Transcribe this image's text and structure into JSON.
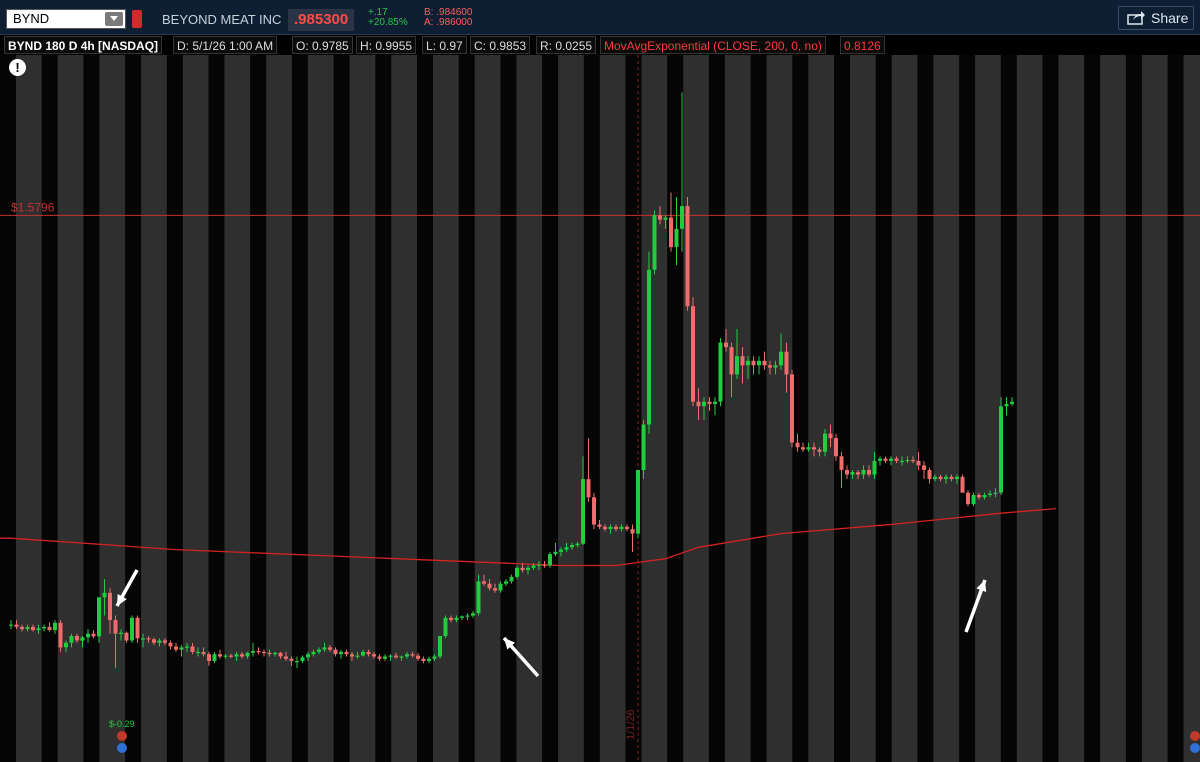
{
  "header": {
    "symbol": "BYND",
    "company": "BEYOND MEAT INC",
    "last": ".985300",
    "change": "+.17",
    "change_pct": "+20.85%",
    "bid": "B: .984600",
    "ask": "A: .986000",
    "share_label": "Share"
  },
  "infobar": {
    "study": "BYND 180 D 4h [NASDAQ]",
    "date": "D: 5/1/26 1:00 AM",
    "open": "O: 0.9785",
    "high": "H: 0.9955",
    "low": "L: 0.97",
    "close": "C: 0.9853",
    "range": "R: 0.0255",
    "ma_label": "MovAvgExponential (CLOSE, 200, 0, no)",
    "ma_value": "0.8126"
  },
  "alert_icon": "exclamation-icon",
  "colors": {
    "up": "#22cc3f",
    "down": "#f06b6b",
    "ma": "#d42222",
    "level": "#c43232",
    "info_white": "#ffffff",
    "info_red": "#ff3b3b"
  },
  "chart_data": {
    "type": "candlestick",
    "price_line": {
      "label": "$1.5796",
      "value": 1.5796
    },
    "earnings_label": "$-0.29",
    "date_marker": "1/1/26",
    "ylim": [
      0.4,
      1.93
    ],
    "candles": [
      [
        0.68,
        0.69,
        0.67,
        0.68
      ],
      [
        0.68,
        0.69,
        0.67,
        0.675
      ],
      [
        0.675,
        0.68,
        0.665,
        0.67
      ],
      [
        0.67,
        0.68,
        0.665,
        0.675
      ],
      [
        0.675,
        0.68,
        0.665,
        0.668
      ],
      [
        0.668,
        0.68,
        0.66,
        0.672
      ],
      [
        0.672,
        0.68,
        0.665,
        0.675
      ],
      [
        0.675,
        0.685,
        0.665,
        0.668
      ],
      [
        0.668,
        0.69,
        0.66,
        0.684
      ],
      [
        0.684,
        0.69,
        0.62,
        0.63
      ],
      [
        0.63,
        0.645,
        0.62,
        0.64
      ],
      [
        0.64,
        0.66,
        0.63,
        0.655
      ],
      [
        0.655,
        0.66,
        0.64,
        0.645
      ],
      [
        0.645,
        0.655,
        0.63,
        0.652
      ],
      [
        0.652,
        0.67,
        0.64,
        0.66
      ],
      [
        0.66,
        0.668,
        0.65,
        0.654
      ],
      [
        0.654,
        0.7,
        0.64,
        0.74
      ],
      [
        0.74,
        0.78,
        0.7,
        0.75
      ],
      [
        0.75,
        0.76,
        0.66,
        0.69
      ],
      [
        0.69,
        0.7,
        0.585,
        0.66
      ],
      [
        0.66,
        0.67,
        0.645,
        0.662
      ],
      [
        0.662,
        0.665,
        0.64,
        0.645
      ],
      [
        0.645,
        0.7,
        0.64,
        0.695
      ],
      [
        0.695,
        0.7,
        0.64,
        0.65
      ],
      [
        0.65,
        0.66,
        0.63,
        0.65
      ],
      [
        0.65,
        0.655,
        0.64,
        0.648
      ],
      [
        0.648,
        0.652,
        0.635,
        0.64
      ],
      [
        0.64,
        0.65,
        0.632,
        0.645
      ],
      [
        0.645,
        0.65,
        0.635,
        0.64
      ],
      [
        0.64,
        0.645,
        0.625,
        0.632
      ],
      [
        0.632,
        0.64,
        0.62,
        0.625
      ],
      [
        0.625,
        0.635,
        0.61,
        0.63
      ],
      [
        0.63,
        0.64,
        0.62,
        0.632
      ],
      [
        0.632,
        0.64,
        0.615,
        0.62
      ],
      [
        0.62,
        0.63,
        0.61,
        0.62
      ],
      [
        0.62,
        0.63,
        0.61,
        0.615
      ],
      [
        0.615,
        0.62,
        0.59,
        0.6
      ],
      [
        0.6,
        0.62,
        0.595,
        0.615
      ],
      [
        0.615,
        0.625,
        0.605,
        0.61
      ],
      [
        0.61,
        0.615,
        0.605,
        0.612
      ],
      [
        0.612,
        0.616,
        0.606,
        0.61
      ],
      [
        0.61,
        0.62,
        0.6,
        0.615
      ],
      [
        0.615,
        0.62,
        0.605,
        0.61
      ],
      [
        0.61,
        0.62,
        0.605,
        0.618
      ],
      [
        0.618,
        0.64,
        0.61,
        0.622
      ],
      [
        0.622,
        0.63,
        0.615,
        0.62
      ],
      [
        0.62,
        0.625,
        0.61,
        0.618
      ],
      [
        0.618,
        0.625,
        0.61,
        0.615
      ],
      [
        0.615,
        0.62,
        0.61,
        0.618
      ],
      [
        0.618,
        0.62,
        0.605,
        0.61
      ],
      [
        0.61,
        0.62,
        0.6,
        0.605
      ],
      [
        0.605,
        0.61,
        0.59,
        0.6
      ],
      [
        0.6,
        0.61,
        0.585,
        0.6
      ],
      [
        0.6,
        0.612,
        0.595,
        0.608
      ],
      [
        0.608,
        0.62,
        0.6,
        0.615
      ],
      [
        0.615,
        0.625,
        0.61,
        0.62
      ],
      [
        0.62,
        0.63,
        0.615,
        0.625
      ],
      [
        0.625,
        0.64,
        0.62,
        0.63
      ],
      [
        0.63,
        0.635,
        0.62,
        0.625
      ],
      [
        0.625,
        0.63,
        0.61,
        0.615
      ],
      [
        0.615,
        0.625,
        0.605,
        0.62
      ],
      [
        0.62,
        0.625,
        0.61,
        0.615
      ],
      [
        0.615,
        0.62,
        0.6,
        0.61
      ],
      [
        0.61,
        0.62,
        0.605,
        0.612
      ],
      [
        0.612,
        0.625,
        0.61,
        0.62
      ],
      [
        0.62,
        0.625,
        0.61,
        0.615
      ],
      [
        0.615,
        0.62,
        0.605,
        0.61
      ],
      [
        0.61,
        0.615,
        0.6,
        0.605
      ],
      [
        0.605,
        0.615,
        0.6,
        0.61
      ],
      [
        0.61,
        0.615,
        0.6,
        0.612
      ],
      [
        0.612,
        0.618,
        0.605,
        0.608
      ],
      [
        0.608,
        0.612,
        0.6,
        0.61
      ],
      [
        0.61,
        0.62,
        0.605,
        0.615
      ],
      [
        0.615,
        0.62,
        0.608,
        0.612
      ],
      [
        0.612,
        0.618,
        0.6,
        0.605
      ],
      [
        0.605,
        0.61,
        0.595,
        0.6
      ],
      [
        0.6,
        0.61,
        0.595,
        0.605
      ],
      [
        0.605,
        0.615,
        0.6,
        0.61
      ],
      [
        0.61,
        0.65,
        0.605,
        0.655
      ],
      [
        0.655,
        0.7,
        0.65,
        0.695
      ],
      [
        0.695,
        0.7,
        0.685,
        0.69
      ],
      [
        0.69,
        0.7,
        0.685,
        0.695
      ],
      [
        0.695,
        0.7,
        0.69,
        0.698
      ],
      [
        0.698,
        0.705,
        0.69,
        0.7
      ],
      [
        0.7,
        0.71,
        0.695,
        0.705
      ],
      [
        0.705,
        0.79,
        0.7,
        0.775
      ],
      [
        0.775,
        0.79,
        0.765,
        0.77
      ],
      [
        0.77,
        0.78,
        0.755,
        0.76
      ],
      [
        0.76,
        0.77,
        0.75,
        0.755
      ],
      [
        0.755,
        0.775,
        0.75,
        0.77
      ],
      [
        0.77,
        0.78,
        0.765,
        0.775
      ],
      [
        0.775,
        0.79,
        0.77,
        0.785
      ],
      [
        0.785,
        0.81,
        0.78,
        0.805
      ],
      [
        0.805,
        0.815,
        0.795,
        0.8
      ],
      [
        0.8,
        0.81,
        0.79,
        0.805
      ],
      [
        0.805,
        0.815,
        0.8,
        0.81
      ],
      [
        0.81,
        0.82,
        0.8,
        0.812
      ],
      [
        0.812,
        0.82,
        0.805,
        0.81
      ],
      [
        0.81,
        0.84,
        0.805,
        0.835
      ],
      [
        0.835,
        0.86,
        0.83,
        0.84
      ],
      [
        0.84,
        0.85,
        0.83,
        0.845
      ],
      [
        0.845,
        0.86,
        0.84,
        0.85
      ],
      [
        0.85,
        0.86,
        0.845,
        0.855
      ],
      [
        0.855,
        0.862,
        0.85,
        0.858
      ],
      [
        0.858,
        1.05,
        0.855,
        1.0
      ],
      [
        1.0,
        1.09,
        0.95,
        0.96
      ],
      [
        0.96,
        0.97,
        0.89,
        0.9
      ],
      [
        0.9,
        0.91,
        0.89,
        0.895
      ],
      [
        0.895,
        0.9,
        0.885,
        0.89
      ],
      [
        0.89,
        0.9,
        0.88,
        0.895
      ],
      [
        0.895,
        0.9,
        0.885,
        0.89
      ],
      [
        0.89,
        0.9,
        0.885,
        0.895
      ],
      [
        0.895,
        0.9,
        0.885,
        0.89
      ],
      [
        0.89,
        0.9,
        0.84,
        0.88
      ],
      [
        0.88,
        1.02,
        0.87,
        1.02
      ],
      [
        1.02,
        1.13,
        1.0,
        1.12
      ],
      [
        1.12,
        1.5,
        1.1,
        1.46
      ],
      [
        1.46,
        1.59,
        1.45,
        1.58
      ],
      [
        1.58,
        1.6,
        1.56,
        1.57
      ],
      [
        1.57,
        1.58,
        1.55,
        1.575
      ],
      [
        1.575,
        1.63,
        1.5,
        1.51
      ],
      [
        1.51,
        1.62,
        1.47,
        1.55
      ],
      [
        1.55,
        1.85,
        1.5,
        1.6
      ],
      [
        1.6,
        1.62,
        1.37,
        1.38
      ],
      [
        1.38,
        1.4,
        1.16,
        1.17
      ],
      [
        1.17,
        1.2,
        1.13,
        1.16
      ],
      [
        1.16,
        1.18,
        1.13,
        1.17
      ],
      [
        1.17,
        1.18,
        1.15,
        1.165
      ],
      [
        1.165,
        1.18,
        1.14,
        1.17
      ],
      [
        1.17,
        1.31,
        1.16,
        1.3
      ],
      [
        1.3,
        1.33,
        1.28,
        1.29
      ],
      [
        1.29,
        1.3,
        1.18,
        1.23
      ],
      [
        1.23,
        1.33,
        1.22,
        1.27
      ],
      [
        1.27,
        1.29,
        1.21,
        1.25
      ],
      [
        1.25,
        1.27,
        1.22,
        1.26
      ],
      [
        1.26,
        1.27,
        1.23,
        1.25
      ],
      [
        1.25,
        1.27,
        1.23,
        1.26
      ],
      [
        1.26,
        1.28,
        1.24,
        1.25
      ],
      [
        1.25,
        1.26,
        1.23,
        1.245
      ],
      [
        1.245,
        1.26,
        1.23,
        1.25
      ],
      [
        1.25,
        1.32,
        1.24,
        1.28
      ],
      [
        1.28,
        1.3,
        1.19,
        1.23
      ],
      [
        1.23,
        1.24,
        1.07,
        1.08
      ],
      [
        1.08,
        1.1,
        1.06,
        1.07
      ],
      [
        1.07,
        1.08,
        1.06,
        1.065
      ],
      [
        1.065,
        1.08,
        1.06,
        1.07
      ],
      [
        1.07,
        1.08,
        1.05,
        1.065
      ],
      [
        1.065,
        1.07,
        1.05,
        1.06
      ],
      [
        1.06,
        1.11,
        1.05,
        1.1
      ],
      [
        1.1,
        1.12,
        1.07,
        1.09
      ],
      [
        1.09,
        1.1,
        1.04,
        1.05
      ],
      [
        1.05,
        1.06,
        0.98,
        1.02
      ],
      [
        1.02,
        1.03,
        1.0,
        1.01
      ],
      [
        1.01,
        1.02,
        1.0,
        1.015
      ],
      [
        1.015,
        1.02,
        1.0,
        1.01
      ],
      [
        1.01,
        1.03,
        1.0,
        1.02
      ],
      [
        1.02,
        1.03,
        1.005,
        1.01
      ],
      [
        1.01,
        1.06,
        1.0,
        1.04
      ],
      [
        1.04,
        1.05,
        1.03,
        1.045
      ],
      [
        1.045,
        1.05,
        1.035,
        1.04
      ],
      [
        1.04,
        1.05,
        1.03,
        1.045
      ],
      [
        1.045,
        1.05,
        1.035,
        1.04
      ],
      [
        1.04,
        1.05,
        1.03,
        1.04
      ],
      [
        1.04,
        1.05,
        1.035,
        1.042
      ],
      [
        1.042,
        1.05,
        1.035,
        1.04
      ],
      [
        1.04,
        1.06,
        1.02,
        1.03
      ],
      [
        1.03,
        1.04,
        1.0,
        1.02
      ],
      [
        1.02,
        1.025,
        0.99,
        1.0
      ],
      [
        1.0,
        1.01,
        0.995,
        1.005
      ],
      [
        1.005,
        1.01,
        0.995,
        1.0
      ],
      [
        1.0,
        1.01,
        0.99,
        1.005
      ],
      [
        1.005,
        1.01,
        0.995,
        1.0
      ],
      [
        1.0,
        1.01,
        0.99,
        1.005
      ],
      [
        1.005,
        1.01,
        0.97,
        0.97
      ],
      [
        0.97,
        0.975,
        0.94,
        0.945
      ],
      [
        0.945,
        0.97,
        0.94,
        0.965
      ],
      [
        0.965,
        0.97,
        0.955,
        0.96
      ],
      [
        0.96,
        0.97,
        0.955,
        0.965
      ],
      [
        0.965,
        0.975,
        0.96,
        0.968
      ],
      [
        0.968,
        0.98,
        0.96,
        0.97
      ],
      [
        0.97,
        1.18,
        0.965,
        1.16
      ],
      [
        1.16,
        1.18,
        1.14,
        1.165
      ],
      [
        1.165,
        1.18,
        1.16,
        1.17
      ]
    ],
    "ma200": [
      [
        0,
        0.87
      ],
      [
        30,
        0.845
      ],
      [
        60,
        0.83
      ],
      [
        90,
        0.815
      ],
      [
        100,
        0.81
      ],
      [
        110,
        0.81
      ],
      [
        119,
        0.825
      ],
      [
        125,
        0.85
      ],
      [
        140,
        0.88
      ],
      [
        160,
        0.9
      ],
      [
        180,
        0.925
      ],
      [
        190,
        0.935
      ]
    ]
  }
}
